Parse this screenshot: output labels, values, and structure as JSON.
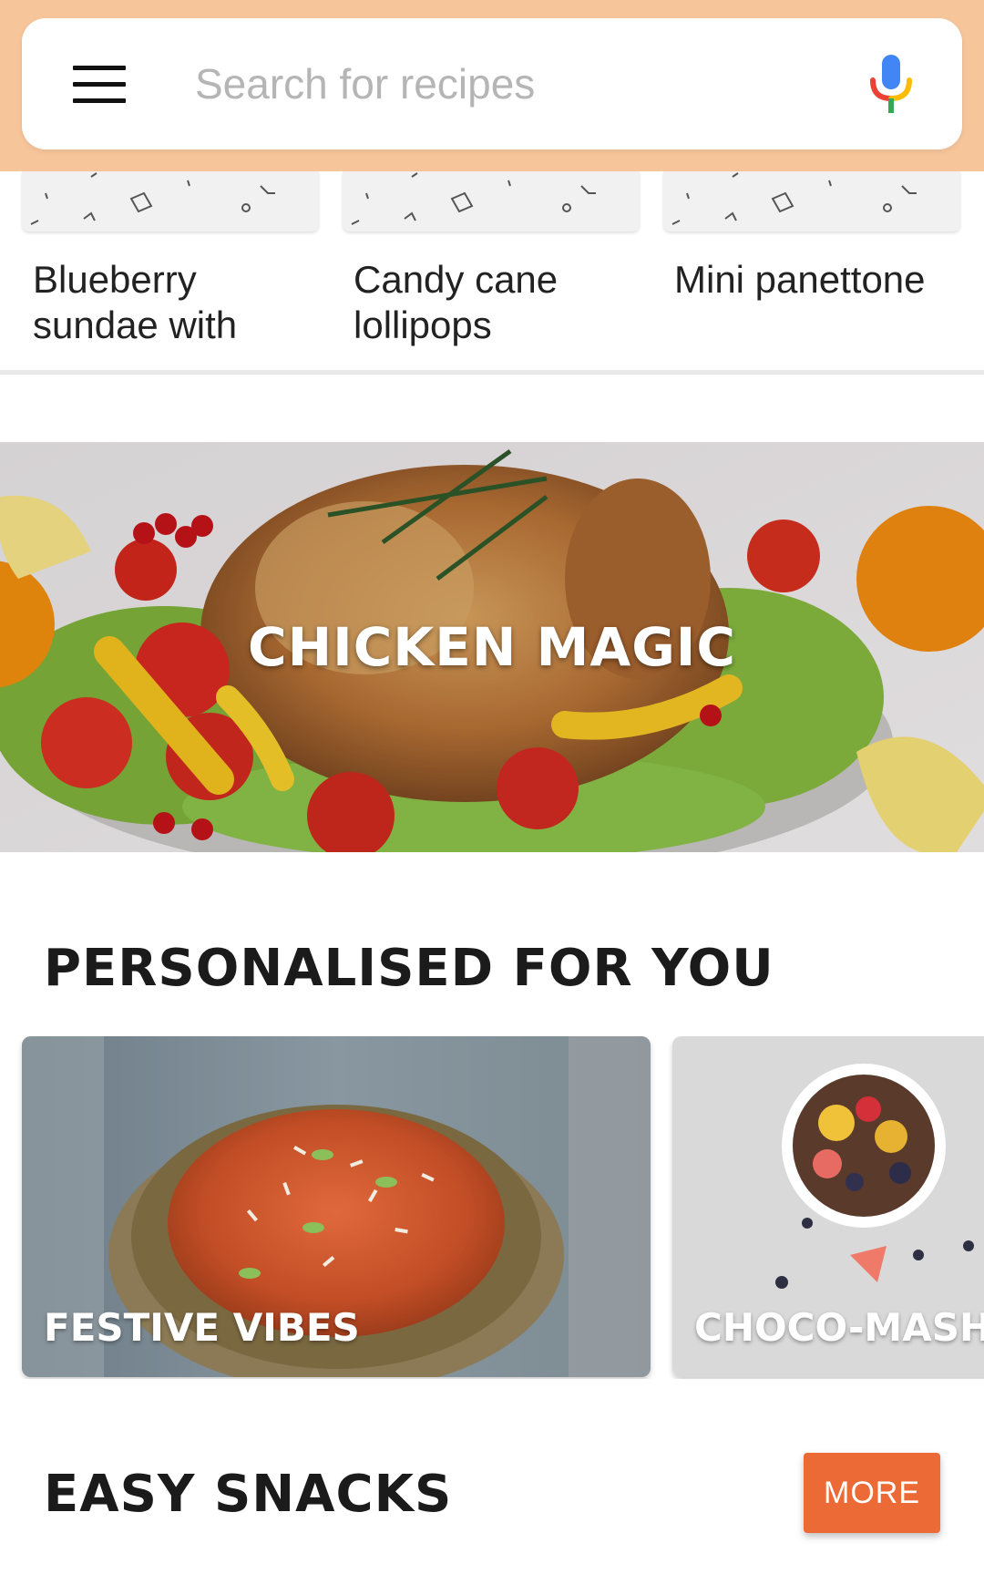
{
  "search": {
    "placeholder": "Search for recipes",
    "menu_icon": "hamburger-menu-icon",
    "mic_icon": "microphone-icon"
  },
  "recent_recipes": [
    {
      "title": "Blueberry sundae with"
    },
    {
      "title": "Candy cane lollipops"
    },
    {
      "title": "Mini panettone"
    }
  ],
  "banner": {
    "title": "CHICKEN MAGIC"
  },
  "personalised": {
    "heading": "PERSONALISED FOR YOU",
    "cards": [
      {
        "label": "FESTIVE VIBES"
      },
      {
        "label": "CHOCO-MASH"
      }
    ]
  },
  "easy_snacks": {
    "heading": "EASY SNACKS",
    "more_label": "MORE"
  },
  "colors": {
    "header_bg": "#f7c59a",
    "accent": "#ec6a35",
    "placeholder": "#b5b5b5"
  }
}
